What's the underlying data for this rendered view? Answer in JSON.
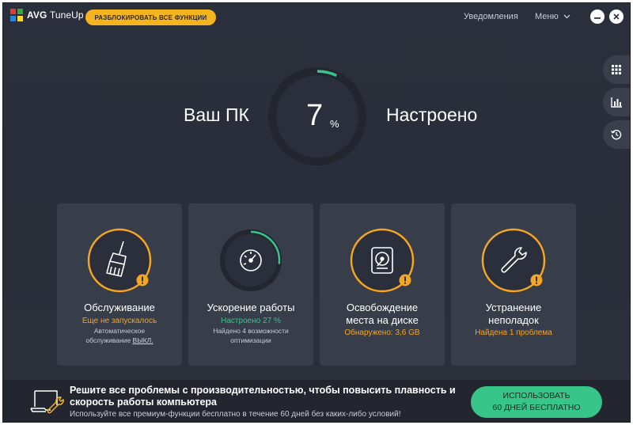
{
  "app": {
    "brand": "AVG",
    "product": "TuneUp"
  },
  "titlebar": {
    "unlock_label": "РАЗБЛОКИРОВАТЬ ВСЕ ФУНКЦИИ",
    "notifications_label": "Уведомления",
    "menu_label": "Меню"
  },
  "side_tools": [
    {
      "icon": "grid-icon"
    },
    {
      "icon": "bar-chart-icon"
    },
    {
      "icon": "history-icon"
    }
  ],
  "gauge": {
    "left_label": "Ваш ПК",
    "value": "7",
    "unit": "%",
    "progress": 0.07,
    "right_label": "Настроено"
  },
  "cards": [
    {
      "icon": "broom-icon",
      "title": "Обслуживание",
      "status": "Еще не запускалось",
      "desc_line1": "Автоматическое",
      "desc_line2_prefix": "обслуживание ",
      "desc_line2_link": "ВЫКЛ.",
      "warning": true
    },
    {
      "icon": "speedometer-icon",
      "title": "Ускорение работы",
      "status": "Настроено 27 %",
      "progress": 0.27,
      "desc_line1": "Найдено 4 возможности",
      "desc_line2": "оптимизации",
      "warning": false
    },
    {
      "icon": "hard-drive-icon",
      "title_line1": "Освобождение",
      "title_line2": "места на диске",
      "status": "Обнаружено: 3,6 GB",
      "warning": true
    },
    {
      "icon": "wrench-icon",
      "title_line1": "Устранение",
      "title_line2": "неполадок",
      "status": "Найдена 1 проблема",
      "warning": true
    }
  ],
  "banner": {
    "title": "Решите все проблемы с производительностью, чтобы повысить плавность и скорость работы компьютера",
    "subtitle": "Используйте все премиум-функции бесплатно в течение 60 дней без каких-либо условий!",
    "cta_line1": "ИСПОЛЬЗОВАТЬ",
    "cta_line2": "60 ДНЕЙ БЕСПЛАТНО"
  },
  "colors": {
    "accent_orange": "#f5a623",
    "accent_green": "#37c58a",
    "unlock_yellow": "#f5b41d",
    "card_bg": "#383d4a"
  }
}
